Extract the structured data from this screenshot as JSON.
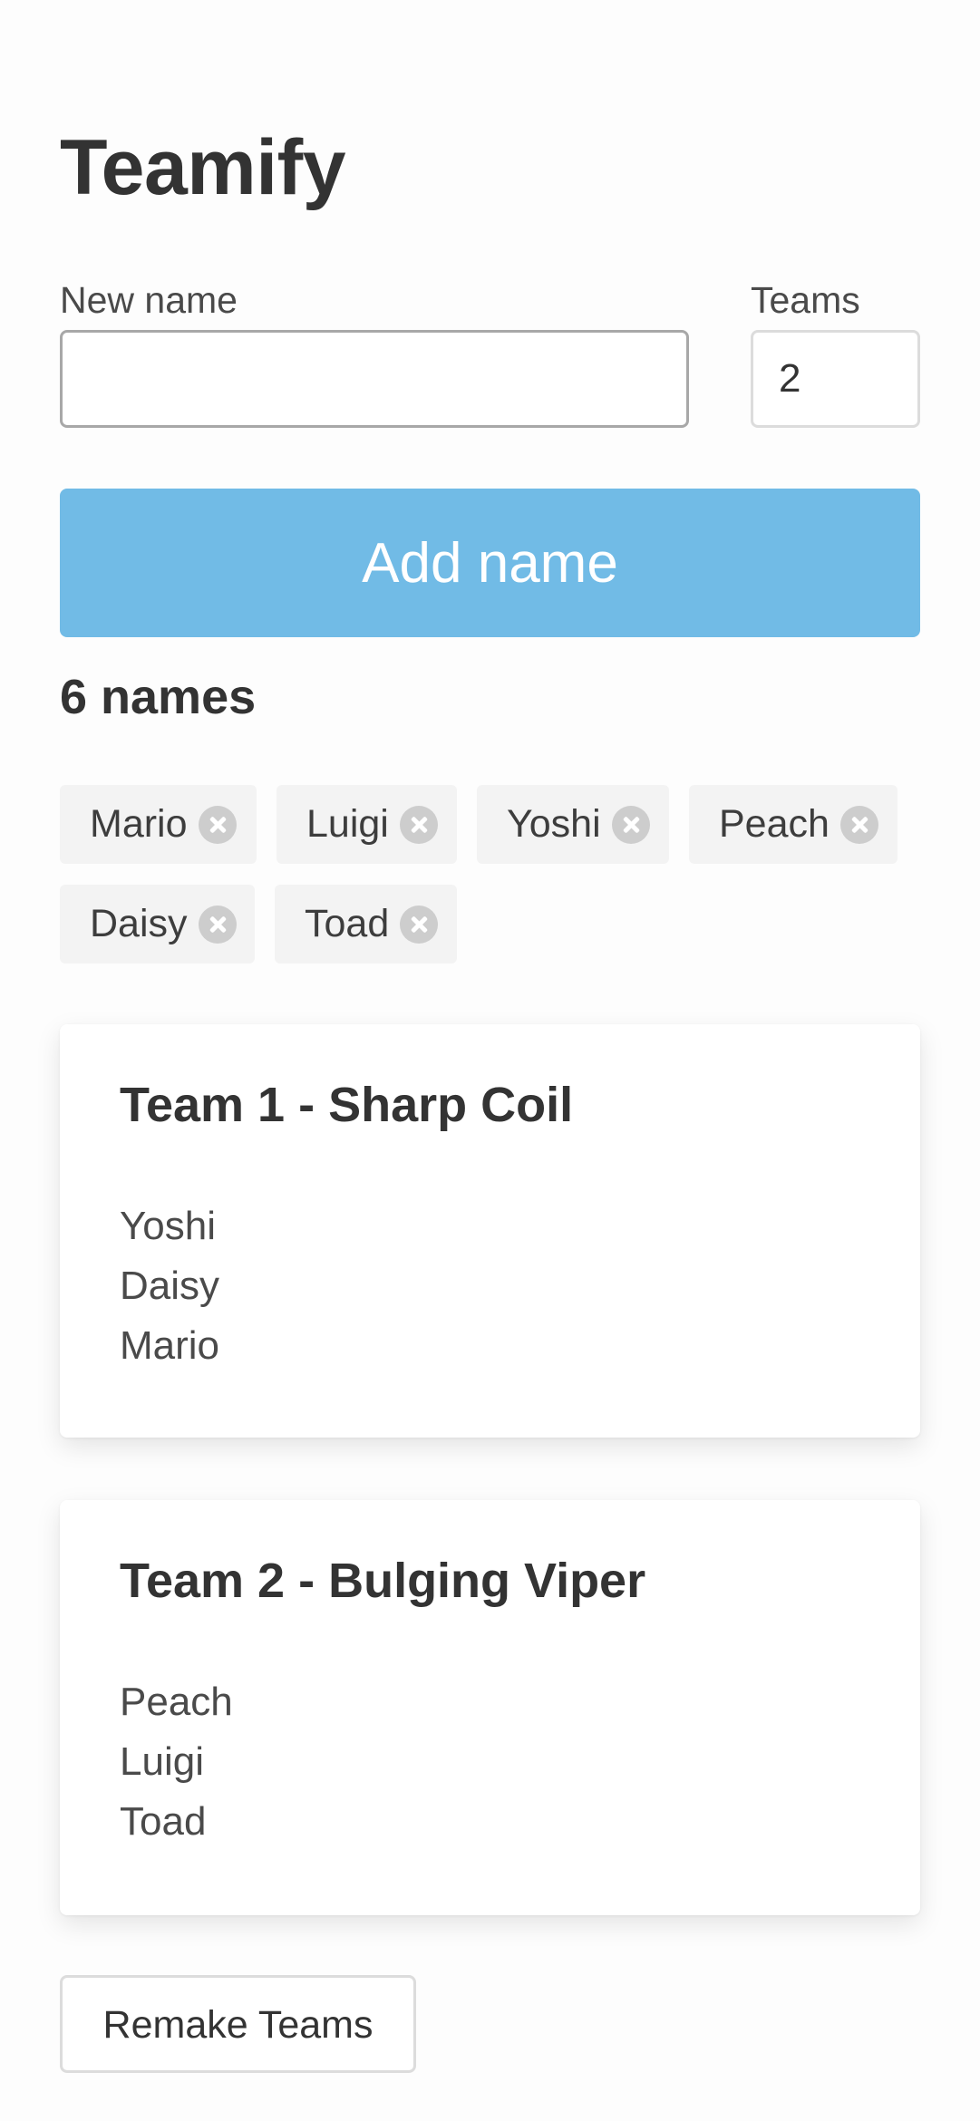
{
  "app": {
    "title": "Teamify"
  },
  "form": {
    "name_label": "New name",
    "name_value": "",
    "teams_label": "Teams",
    "teams_value": "2",
    "add_button_label": "Add name",
    "accent_color": "#71bbe6"
  },
  "names": {
    "count_label": "6 names",
    "items": [
      {
        "label": "Mario",
        "remove_icon": "close-circle-icon"
      },
      {
        "label": "Luigi",
        "remove_icon": "close-circle-icon"
      },
      {
        "label": "Yoshi",
        "remove_icon": "close-circle-icon"
      },
      {
        "label": "Peach",
        "remove_icon": "close-circle-icon"
      },
      {
        "label": "Daisy",
        "remove_icon": "close-circle-icon"
      },
      {
        "label": "Toad",
        "remove_icon": "close-circle-icon"
      }
    ]
  },
  "teams": [
    {
      "title": "Team 1 - Sharp Coil",
      "members": [
        "Yoshi",
        "Daisy",
        "Mario"
      ]
    },
    {
      "title": "Team 2 - Bulging Viper",
      "members": [
        "Peach",
        "Luigi",
        "Toad"
      ]
    }
  ],
  "actions": {
    "remake_label": "Remake Teams"
  }
}
